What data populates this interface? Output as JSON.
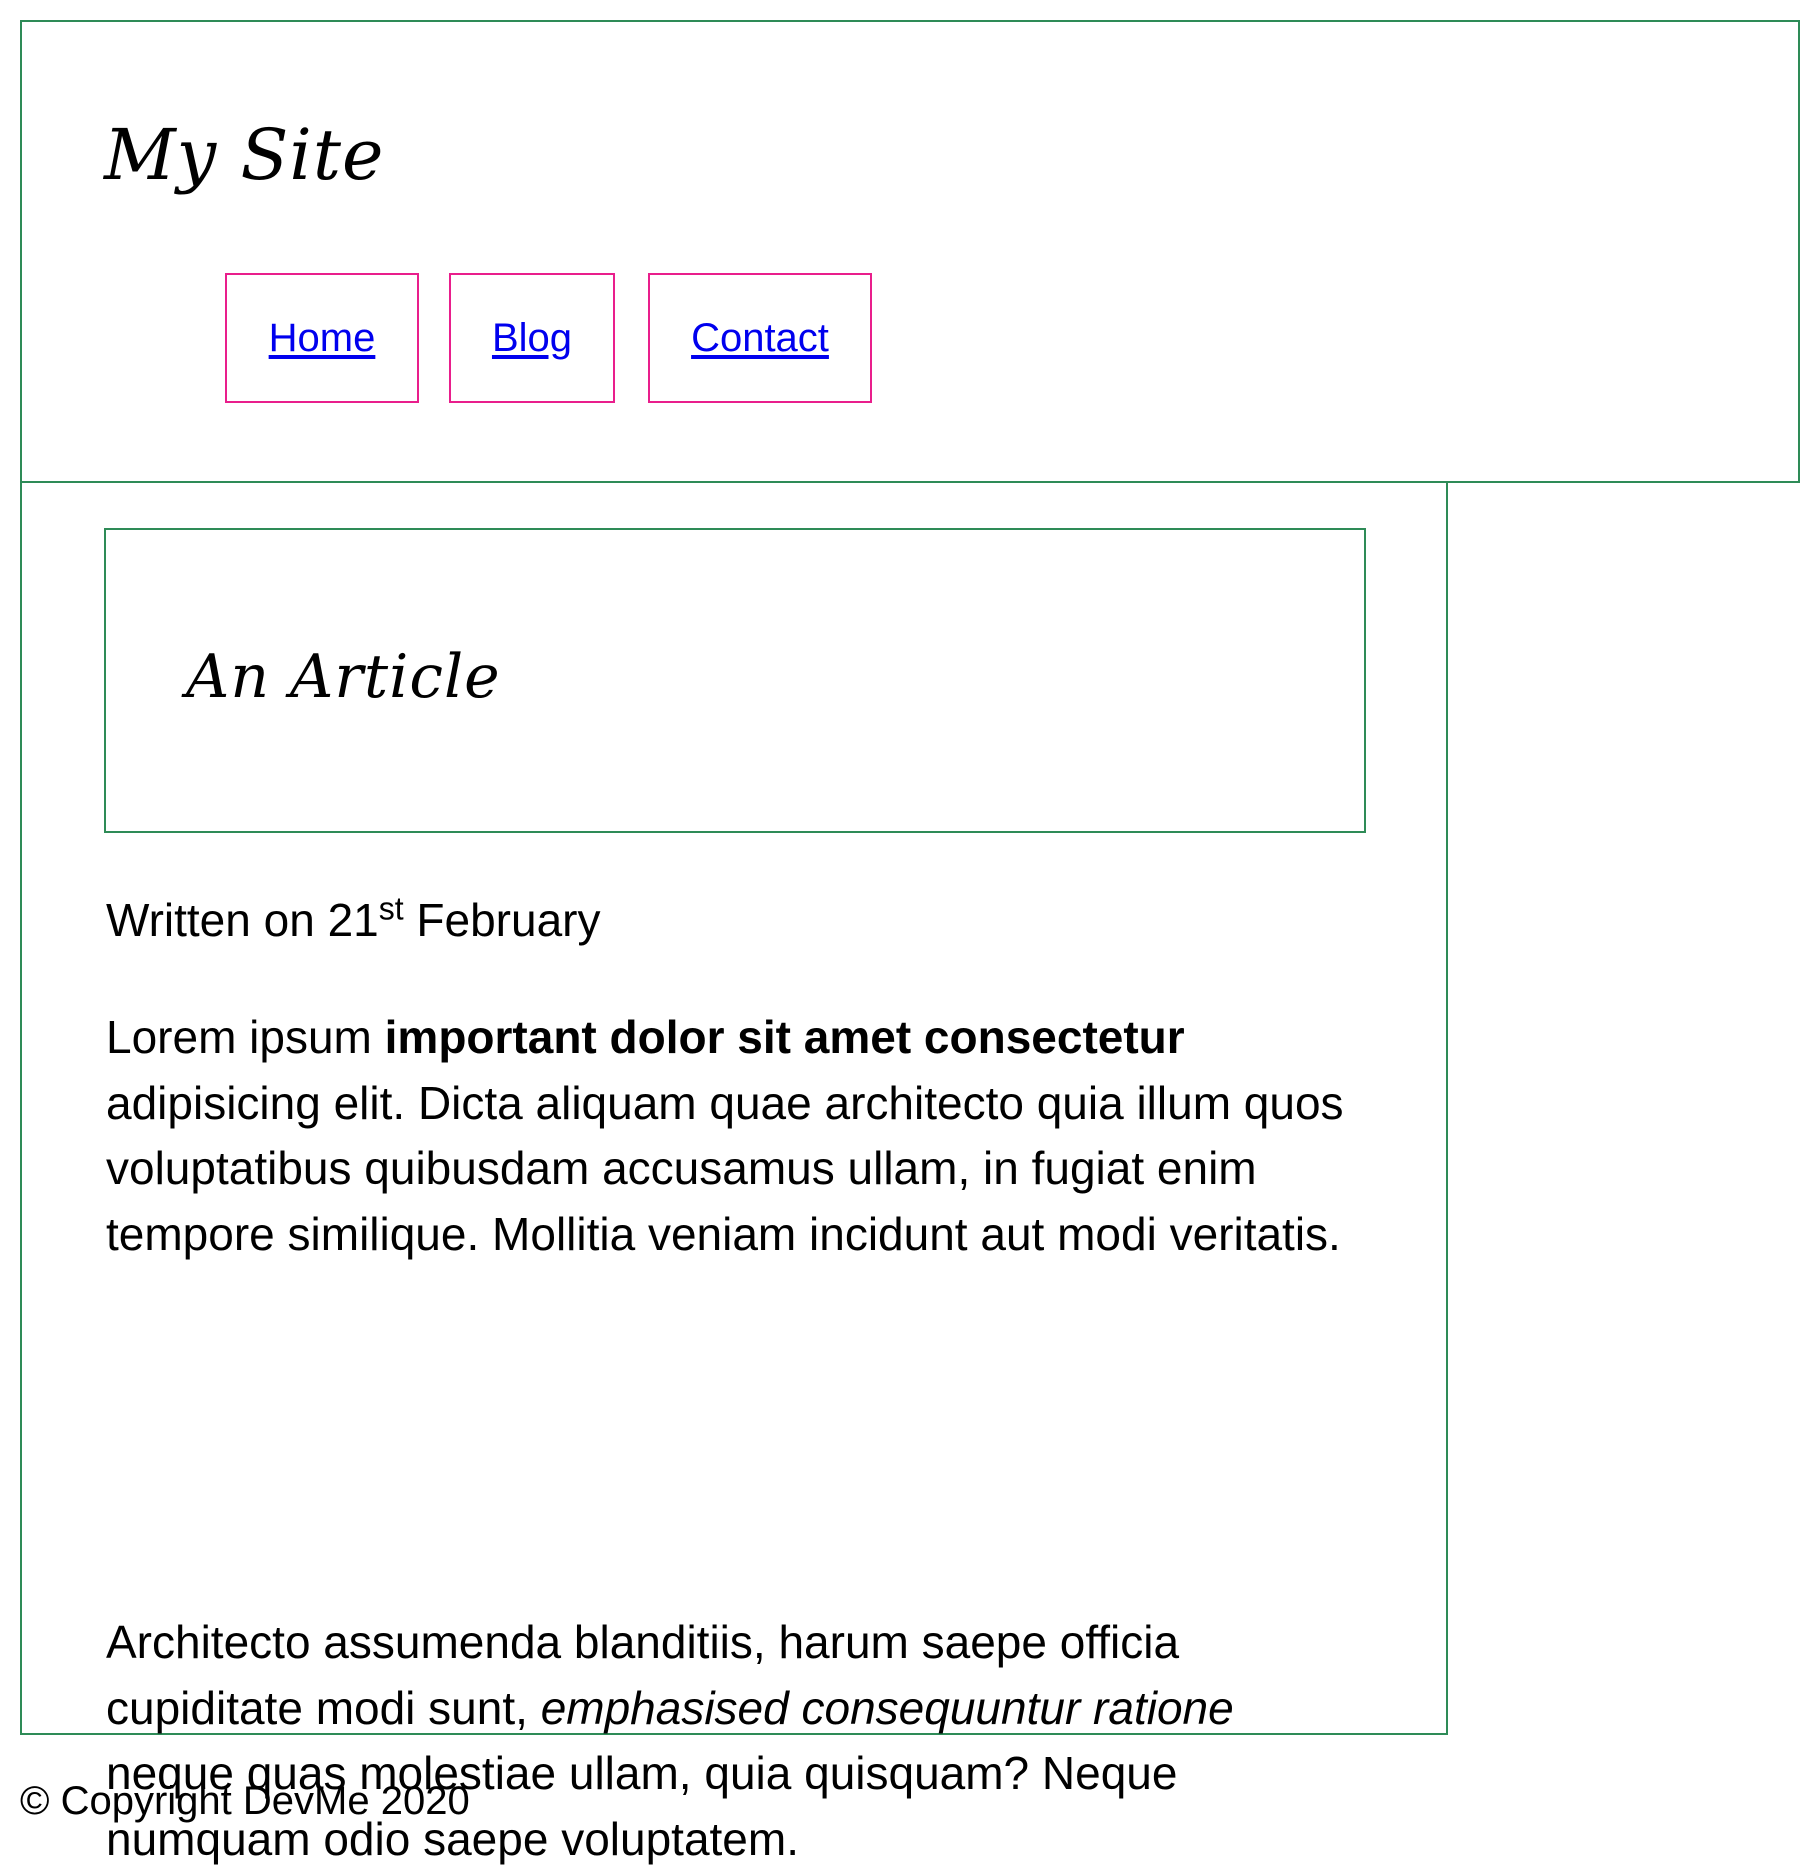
{
  "header": {
    "site_title": "My Site",
    "nav": [
      {
        "label": "Home"
      },
      {
        "label": "Blog"
      },
      {
        "label": "Contact"
      }
    ]
  },
  "article": {
    "title": "An Article",
    "byline": {
      "prefix": "Written on 21",
      "suffix": "st",
      "month": " February"
    },
    "paragraph1": {
      "start": "Lorem ipsum ",
      "strong": "important dolor sit amet consectetur",
      "end": " adipisicing elit. Dicta aliquam quae architecto quia illum quos voluptatibus quibusdam accusamus ullam, in fugiat enim tempore similique. Mollitia veniam incidunt aut modi veritatis."
    },
    "paragraph2": {
      "start": "Architecto assumenda blanditiis, harum saepe officia cupiditate modi sunt, ",
      "emphasis": "emphasised consequuntur ratione",
      "end": " neque quas molestiae ullam, quia quisquam? Neque numquam odio saepe voluptatem."
    }
  },
  "footer": {
    "copyright": "© Copyright DevMe 2020"
  },
  "colors": {
    "box_border": "#2e8b57",
    "nav_border": "#e91e8c",
    "link": "#0000ee"
  }
}
